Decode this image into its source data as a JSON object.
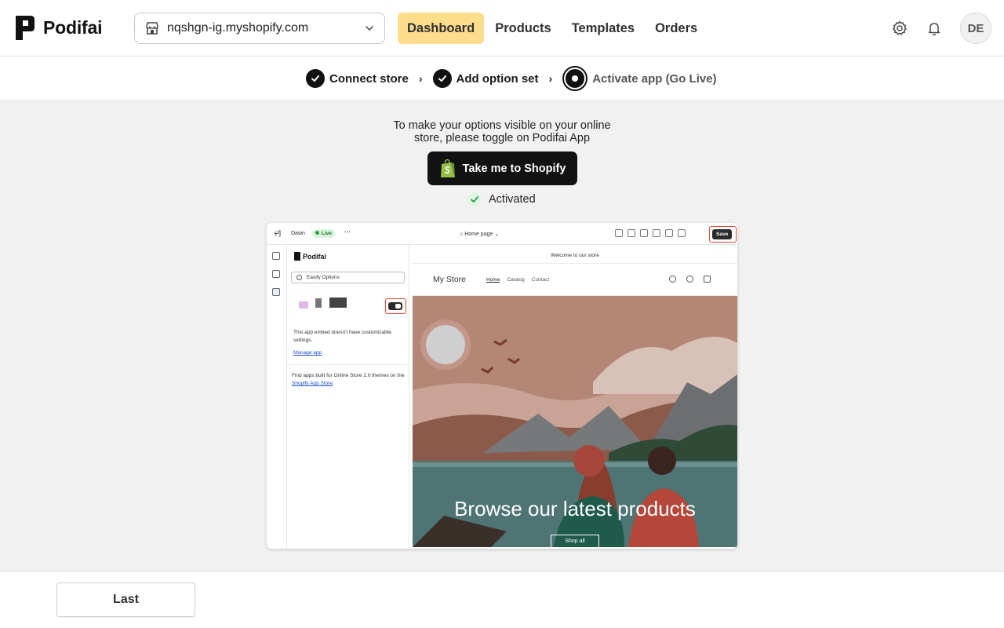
{
  "header": {
    "brand": "Podifai",
    "store": "nqshgn-ig.myshopify.com",
    "nav": [
      "Dashboard",
      "Products",
      "Templates",
      "Orders"
    ],
    "active_nav": "Dashboard",
    "avatar_initials": "DE"
  },
  "stepper": {
    "steps": [
      "Connect store",
      "Add option set",
      "Activate app (Go Live)"
    ],
    "separator": "›"
  },
  "main": {
    "instructions_line1": "To make your options visible on your online",
    "instructions_line2": "store, please toggle on Podifai App",
    "shopify_button": "Take me to Shopify",
    "activated_label": "Activated"
  },
  "preview": {
    "theme_name": "Dawn",
    "live_badge": "Live",
    "more": "···",
    "page_select": "Home page",
    "save_label": "Save",
    "app_name": "Podifai",
    "search_value": "Easify Options",
    "embed_note": "This app embed doesn't have customizable settings.",
    "manage_link": "Manage app",
    "find_apps_text": "Find apps built for Online Store 2.0 themes on the",
    "app_store_link": "Shopify App Store",
    "announcement": "Welcome to our store",
    "store_name": "My Store",
    "store_nav": [
      "Home",
      "Catalog",
      "Contact"
    ],
    "hero_title": "Browse our latest products",
    "hero_button": "Shop all"
  },
  "footer": {
    "last_button": "Last"
  },
  "colors": {
    "active_nav_bg": "#fbdd8c",
    "primary_dark": "#121212",
    "highlight_ring": "#e04b37",
    "success": "#24a148"
  }
}
